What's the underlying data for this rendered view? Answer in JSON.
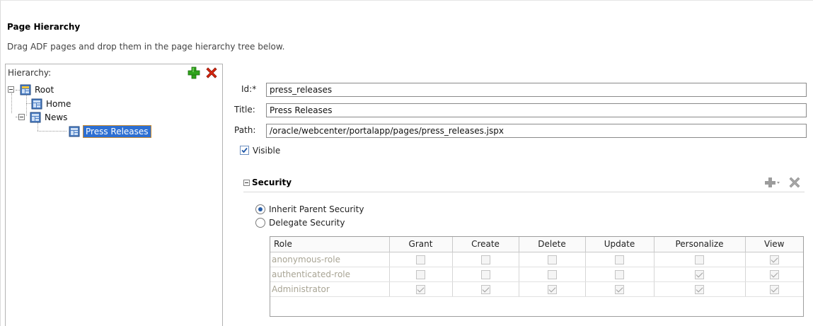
{
  "page": {
    "title": "Page Hierarchy",
    "subtitle": "Drag ADF pages and drop them in the page hierarchy tree below."
  },
  "hierarchy": {
    "label": "Hierarchy:",
    "add_icon": "green-plus-icon",
    "delete_icon": "red-x-icon",
    "nodes": [
      {
        "label": "Root",
        "icon": "root-page-icon",
        "expanded": true
      },
      {
        "label": "Home",
        "icon": "page-icon"
      },
      {
        "label": "News",
        "icon": "page-icon",
        "expanded": true
      },
      {
        "label": "Press Releases",
        "icon": "page-icon",
        "selected": true
      }
    ]
  },
  "form": {
    "id_label": "Id:*",
    "id_value": "press_releases",
    "title_label": "Title:",
    "title_value": "Press Releases",
    "path_label": "Path:",
    "path_value": "/oracle/webcenter/portalapp/pages/press_releases.jspx",
    "visible_label": "Visible",
    "visible_checked": true
  },
  "security": {
    "title": "Security",
    "add_icon": "gray-plus-dropdown-icon",
    "delete_icon": "gray-x-icon",
    "inherit_label": "Inherit Parent Security",
    "delegate_label": "Delegate Security",
    "selected": "inherit",
    "table": {
      "columns": [
        "Role",
        "Grant",
        "Create",
        "Delete",
        "Update",
        "Personalize",
        "View"
      ],
      "rows": [
        {
          "role": "anonymous-role",
          "perms": [
            false,
            false,
            false,
            false,
            false,
            true
          ]
        },
        {
          "role": "authenticated-role",
          "perms": [
            false,
            false,
            false,
            false,
            true,
            true
          ]
        },
        {
          "role": "Administrator",
          "perms": [
            true,
            true,
            true,
            true,
            true,
            true
          ]
        }
      ]
    }
  },
  "colors": {
    "selection": "#2d6fd2",
    "selection_border": "#c98a2e",
    "add_green": "#2fa31c",
    "delete_red": "#d9260f",
    "disabled_text": "#a8a494"
  }
}
